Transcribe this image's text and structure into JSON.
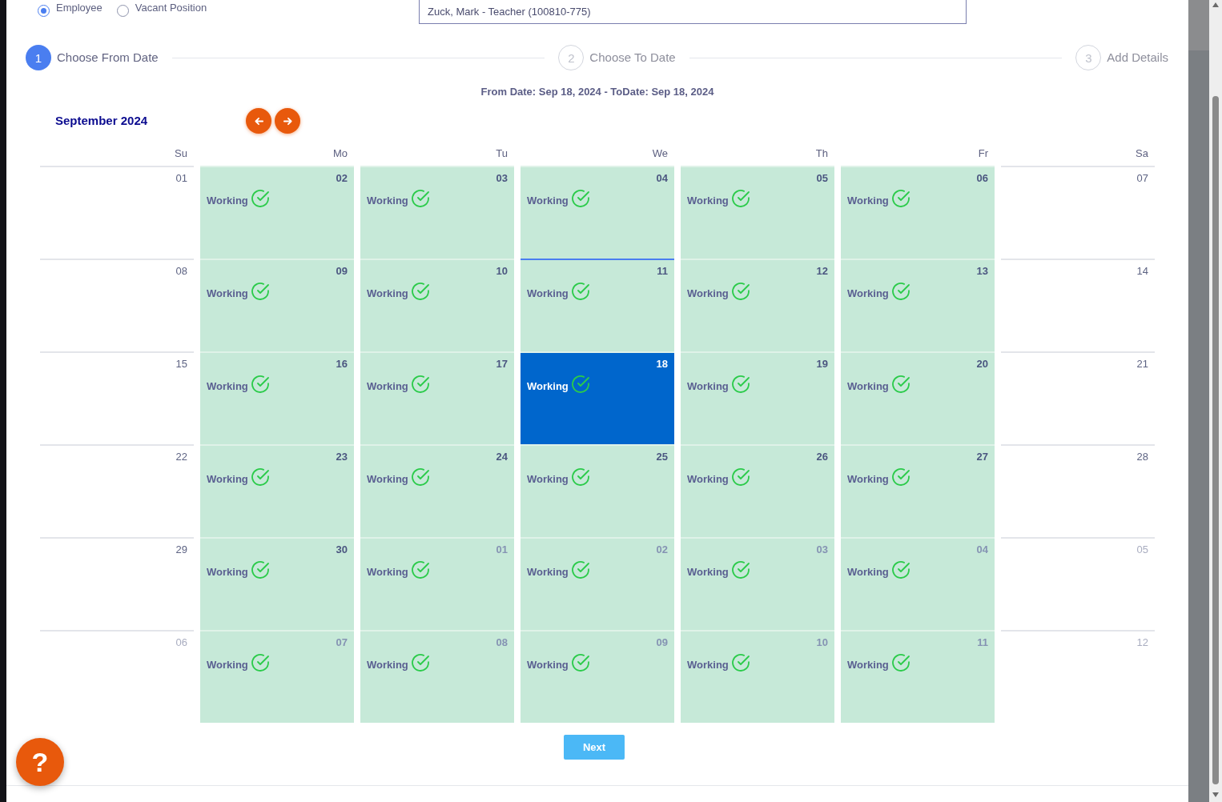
{
  "assignee_type": [
    {
      "label": "Employee",
      "selected": true
    },
    {
      "label": "Vacant Position",
      "selected": false
    }
  ],
  "employee_field": {
    "value": "Zuck, Mark - Teacher (100810-775)"
  },
  "steps": [
    {
      "number": "1",
      "label": "Choose From Date",
      "active": true
    },
    {
      "number": "2",
      "label": "Choose To Date",
      "active": false
    },
    {
      "number": "3",
      "label": "Add Details",
      "active": false
    }
  ],
  "date_range": "From Date: Sep 18, 2024 - ToDate: Sep 18, 2024",
  "calendar": {
    "month_title": "September 2024",
    "weekdays": [
      "Su",
      "Mo",
      "Tu",
      "We",
      "Th",
      "Fr",
      "Sa"
    ],
    "weeks": [
      {
        "days": [
          {
            "day": "01",
            "kind": "weekend",
            "other_month": false,
            "selected": false,
            "today": false
          },
          {
            "day": "02",
            "kind": "working",
            "status": "Working",
            "other_month": false,
            "selected": false,
            "today": false
          },
          {
            "day": "03",
            "kind": "working",
            "status": "Working",
            "other_month": false,
            "selected": false,
            "today": false
          },
          {
            "day": "04",
            "kind": "working",
            "status": "Working",
            "other_month": false,
            "selected": false,
            "today": false
          },
          {
            "day": "05",
            "kind": "working",
            "status": "Working",
            "other_month": false,
            "selected": false,
            "today": false
          },
          {
            "day": "06",
            "kind": "working",
            "status": "Working",
            "other_month": false,
            "selected": false,
            "today": false
          },
          {
            "day": "07",
            "kind": "weekend",
            "other_month": false,
            "selected": false,
            "today": false
          }
        ]
      },
      {
        "days": [
          {
            "day": "08",
            "kind": "weekend",
            "other_month": false,
            "selected": false,
            "today": false
          },
          {
            "day": "09",
            "kind": "working",
            "status": "Working",
            "other_month": false,
            "selected": false,
            "today": false
          },
          {
            "day": "10",
            "kind": "working",
            "status": "Working",
            "other_month": false,
            "selected": false,
            "today": false
          },
          {
            "day": "11",
            "kind": "working",
            "status": "Working",
            "other_month": false,
            "selected": false,
            "today": true
          },
          {
            "day": "12",
            "kind": "working",
            "status": "Working",
            "other_month": false,
            "selected": false,
            "today": false
          },
          {
            "day": "13",
            "kind": "working",
            "status": "Working",
            "other_month": false,
            "selected": false,
            "today": false
          },
          {
            "day": "14",
            "kind": "weekend",
            "other_month": false,
            "selected": false,
            "today": false
          }
        ]
      },
      {
        "days": [
          {
            "day": "15",
            "kind": "weekend",
            "other_month": false,
            "selected": false,
            "today": false
          },
          {
            "day": "16",
            "kind": "working",
            "status": "Working",
            "other_month": false,
            "selected": false,
            "today": false
          },
          {
            "day": "17",
            "kind": "working",
            "status": "Working",
            "other_month": false,
            "selected": false,
            "today": false
          },
          {
            "day": "18",
            "kind": "working",
            "status": "Working",
            "other_month": false,
            "selected": true,
            "today": false
          },
          {
            "day": "19",
            "kind": "working",
            "status": "Working",
            "other_month": false,
            "selected": false,
            "today": false
          },
          {
            "day": "20",
            "kind": "working",
            "status": "Working",
            "other_month": false,
            "selected": false,
            "today": false
          },
          {
            "day": "21",
            "kind": "weekend",
            "other_month": false,
            "selected": false,
            "today": false
          }
        ]
      },
      {
        "days": [
          {
            "day": "22",
            "kind": "weekend",
            "other_month": false,
            "selected": false,
            "today": false
          },
          {
            "day": "23",
            "kind": "working",
            "status": "Working",
            "other_month": false,
            "selected": false,
            "today": false
          },
          {
            "day": "24",
            "kind": "working",
            "status": "Working",
            "other_month": false,
            "selected": false,
            "today": false
          },
          {
            "day": "25",
            "kind": "working",
            "status": "Working",
            "other_month": false,
            "selected": false,
            "today": false
          },
          {
            "day": "26",
            "kind": "working",
            "status": "Working",
            "other_month": false,
            "selected": false,
            "today": false
          },
          {
            "day": "27",
            "kind": "working",
            "status": "Working",
            "other_month": false,
            "selected": false,
            "today": false
          },
          {
            "day": "28",
            "kind": "weekend",
            "other_month": false,
            "selected": false,
            "today": false
          }
        ]
      },
      {
        "days": [
          {
            "day": "29",
            "kind": "weekend",
            "other_month": false,
            "selected": false,
            "today": false
          },
          {
            "day": "30",
            "kind": "working",
            "status": "Working",
            "other_month": false,
            "selected": false,
            "today": false
          },
          {
            "day": "01",
            "kind": "working",
            "status": "Working",
            "other_month": true,
            "selected": false,
            "today": false
          },
          {
            "day": "02",
            "kind": "working",
            "status": "Working",
            "other_month": true,
            "selected": false,
            "today": false
          },
          {
            "day": "03",
            "kind": "working",
            "status": "Working",
            "other_month": true,
            "selected": false,
            "today": false
          },
          {
            "day": "04",
            "kind": "working",
            "status": "Working",
            "other_month": true,
            "selected": false,
            "today": false
          },
          {
            "day": "05",
            "kind": "weekend",
            "other_month": true,
            "selected": false,
            "today": false
          }
        ]
      },
      {
        "days": [
          {
            "day": "06",
            "kind": "weekend",
            "other_month": true,
            "selected": false,
            "today": false
          },
          {
            "day": "07",
            "kind": "working",
            "status": "Working",
            "other_month": true,
            "selected": false,
            "today": false
          },
          {
            "day": "08",
            "kind": "working",
            "status": "Working",
            "other_month": true,
            "selected": false,
            "today": false
          },
          {
            "day": "09",
            "kind": "working",
            "status": "Working",
            "other_month": true,
            "selected": false,
            "today": false
          },
          {
            "day": "10",
            "kind": "working",
            "status": "Working",
            "other_month": true,
            "selected": false,
            "today": false
          },
          {
            "day": "11",
            "kind": "working",
            "status": "Working",
            "other_month": true,
            "selected": false,
            "today": false
          },
          {
            "day": "12",
            "kind": "weekend",
            "other_month": true,
            "selected": false,
            "today": false
          }
        ]
      }
    ]
  },
  "next_button": {
    "label": "Next"
  },
  "help_button": {
    "label": "?"
  }
}
